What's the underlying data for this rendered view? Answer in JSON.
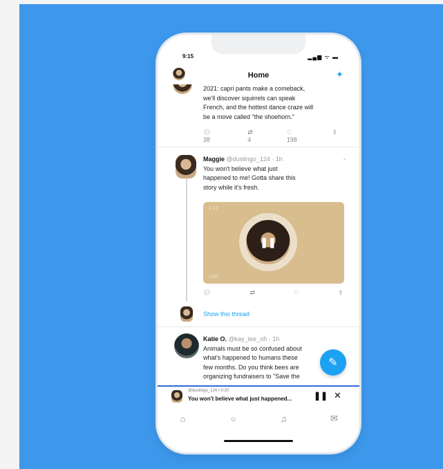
{
  "status": {
    "time": "9:15",
    "icons": "▂▄▆ ᯤ ▬"
  },
  "header": {
    "title": "Home",
    "sparkle_icon": "sparkle-icon"
  },
  "tweets": [
    {
      "text_lines": [
        "2021: capri pants make a comeback,",
        "we'll discover squirrels can speak",
        "French, and the hottest dance craze will",
        "be a move called \"the shoehorn.\""
      ],
      "reply_count": "38",
      "retweet_count": "4",
      "like_count": "198"
    },
    {
      "name": "Maggie",
      "handle": "@dustingo_124 · 1h",
      "text_lines": [
        "You won't believe what just",
        "happened to me! Gotta share this",
        "story while it's fresh."
      ],
      "media_label_top": "1:12",
      "media_label_bottom": "0:00"
    },
    {
      "show_thread": "Show this thread"
    },
    {
      "name": "Katie O.",
      "handle": "@kay_tee_oh · 1h",
      "text_lines": [
        "Animals must be so confused about",
        "what's happened to humans these",
        "few months. Do you think bees are",
        "organizing fundraisers to \"Save the"
      ]
    }
  ],
  "player": {
    "handle": "@dustingo_124 • 0:20",
    "text": "You won't believe what just happened..."
  },
  "colors": {
    "background": "#3d97ea",
    "accent": "#1da1f2",
    "media": "#d8bd8f"
  }
}
